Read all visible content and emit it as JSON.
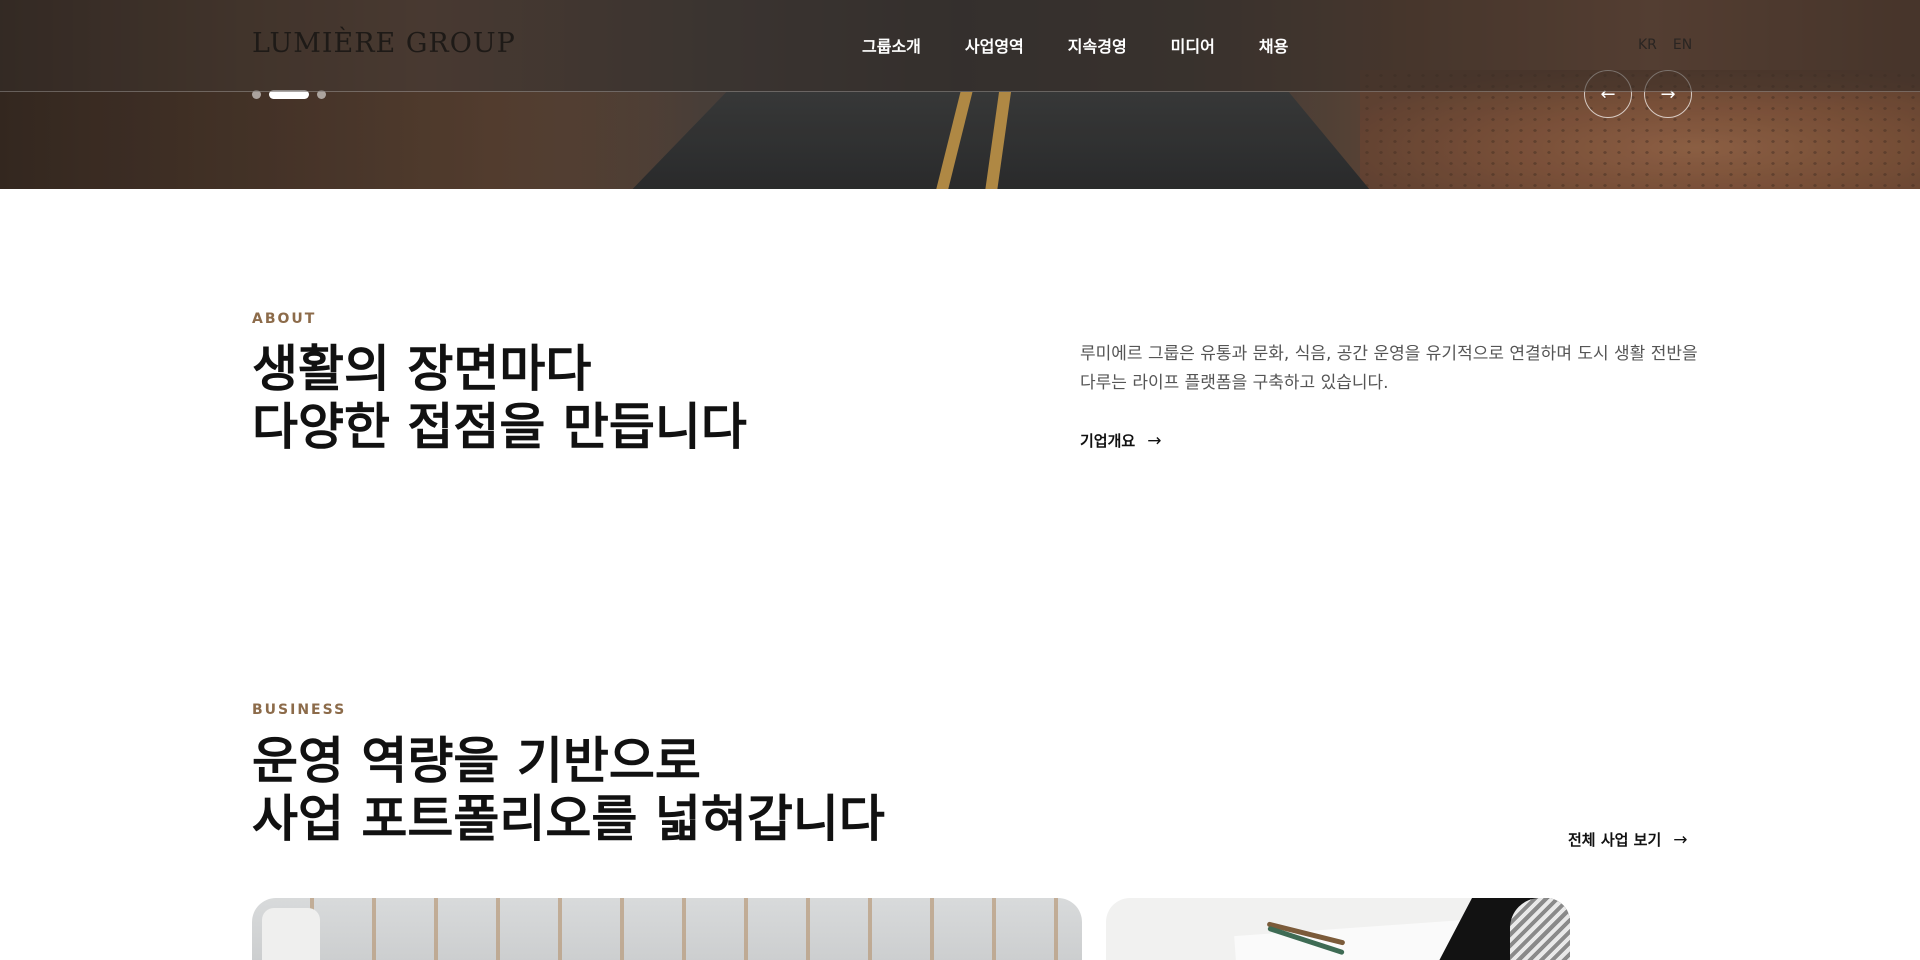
{
  "header": {
    "logo": "LUMIÈRE GROUP",
    "nav": [
      "그룹소개",
      "사업영역",
      "지속경영",
      "미디어",
      "채용"
    ],
    "lang": [
      "KR",
      "EN"
    ]
  },
  "hero": {
    "slides_total": 3,
    "active_slide": 2,
    "prev_icon": "arrow-left-icon",
    "next_icon": "arrow-right-icon"
  },
  "about": {
    "eyebrow": "ABOUT",
    "title_line1": "생활의 장면마다",
    "title_line2": "다양한 접점을 만듭니다",
    "description": "루미에르 그룹은 유통과 문화, 식음, 공간 운영을 유기적으로 연결하며 도시 생활 전반을 다루는 라이프 플랫폼을 구축하고 있습니다.",
    "link_label": "기업개요"
  },
  "business": {
    "eyebrow": "BUSINESS",
    "title_line1": "운영 역량을 기반으로",
    "title_line2": "사업 포트폴리오를 넓혀갑니다",
    "link_label": "전체 사업 보기"
  },
  "colors": {
    "accent": "#8c6b4a",
    "text": "#111111",
    "muted": "#555555"
  }
}
